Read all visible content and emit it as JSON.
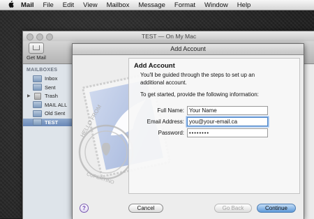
{
  "menubar": {
    "apple": "",
    "items": [
      "Mail",
      "File",
      "Edit",
      "View",
      "Mailbox",
      "Message",
      "Format",
      "Window",
      "Help"
    ]
  },
  "mail_window": {
    "title": "TEST — On My Mac",
    "toolbar": {
      "get_mail": "Get Mail"
    },
    "sidebar": {
      "section": "MAILBOXES",
      "items": [
        "Inbox",
        "Sent",
        "Trash",
        "MAIL ALL",
        "Old Sent",
        "TEST"
      ],
      "selected": "TEST"
    }
  },
  "sheet": {
    "title": "Add Account",
    "heading": "Add Account",
    "intro": "You'll be guided through the steps to set up an additional account.",
    "prompt": "To get started, provide the following information:",
    "fields": {
      "full_name": {
        "label": "Full Name:",
        "value": "Your Name"
      },
      "email": {
        "label": "Email Address:",
        "value": "you@your-email.ca"
      },
      "password": {
        "label": "Password:",
        "value": "••••••••"
      }
    },
    "buttons": {
      "help": "?",
      "cancel": "Cancel",
      "back": "Go Back",
      "continue": "Continue"
    },
    "stamp_text": [
      "HELLO FROM",
      "CUPERTINO"
    ]
  },
  "colors": {
    "accent": "#5e99d8",
    "selection": "#6a88b8",
    "help": "#6a3fb0"
  }
}
